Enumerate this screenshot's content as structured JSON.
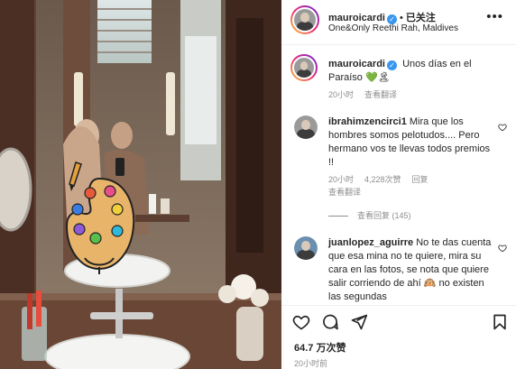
{
  "post": {
    "author": {
      "username": "mauroicardi",
      "verified": true,
      "follow_label": "已关注",
      "dot": "•",
      "location": "One&Only Reethi Rah, Maldives"
    },
    "more_label": "•••",
    "caption": {
      "username": "mauroicardi",
      "text": "Unos días en el Paraíso 💚🏝",
      "time": "20小时",
      "translate": "查看翻译"
    },
    "comments": [
      {
        "username": "ibrahimzencirci1",
        "text": "Mira que los hombres somos pelotudos.... Pero hermano vos te llevas todos premios !!",
        "time": "20小时",
        "likes": "4,228次赞",
        "reply": "回复",
        "translate": "查看翻译",
        "view_replies": "查看回复 (145)"
      },
      {
        "username": "juanlopez_aguirre",
        "text": "No te das cuenta que esa mina no te quiere, mira su cara en las fotos, se nota que quiere salir corriendo de ahí 🙉 no existen las segundas"
      }
    ],
    "likes_count": "64.7 万次赞",
    "posted": "20小时前"
  },
  "icons": [
    "verified-badge-icon",
    "more-icon",
    "heart-icon",
    "comment-icon",
    "share-icon",
    "bookmark-icon",
    "palette-sticker-icon"
  ],
  "colors": {
    "accent": "#3897f0",
    "text": "#262626",
    "secondary": "#8e8e8e"
  }
}
